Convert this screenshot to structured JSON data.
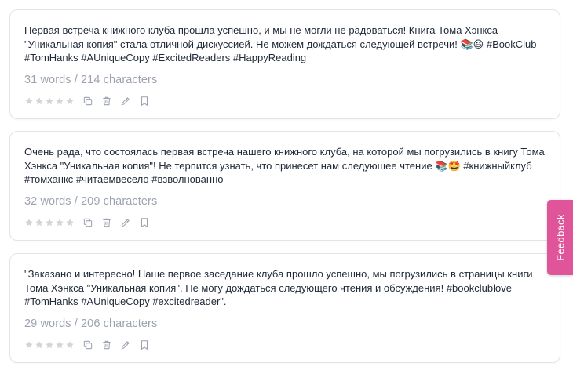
{
  "posts": [
    {
      "text": "Первая встреча книжного клуба прошла успешно, и мы не могли не радоваться! Книга Тома Хэнкса \"Уникальная копия\" стала отличной дискуссией. Не можем дождаться следующей встречи! 📚😃 #BookClub #TomHanks #AUniqueCopy #ExcitedReaders #HappyReading",
      "stats": "31 words / 214 characters",
      "rating": 0
    },
    {
      "text": "Очень рада, что состоялась первая встреча нашего книжного клуба, на которой мы погрузились в книгу Тома Хэнкса \"Уникальная копия\"! Не терпится узнать, что принесет нам следующее чтение 📚🤩 #книжныйклуб #томханкс #читаемвесело #взволнованно",
      "stats": "32 words / 209 characters",
      "rating": 0
    },
    {
      "text": "\"Заказано и интересно! Наше первое заседание клуба прошло успешно, мы погрузились в страницы книги Тома Хэнкса \"Уникальная копия\". Не могу дождаться следующего чтения и обсуждения! #bookclublove #TomHanks #AUniqueCopy #excitedreader\".",
      "stats": "29 words / 206 characters",
      "rating": 0
    }
  ],
  "icons": [
    "star-icon",
    "copy-icon",
    "trash-icon",
    "pencil-icon",
    "bookmark-icon"
  ],
  "colors": {
    "text": "#1f2937",
    "muted": "#9ca3af",
    "icon": "#9ca3af",
    "card_border": "#e4e4e7",
    "feedback_bg": "#e0559a"
  },
  "feedback": {
    "label": "Feedback"
  }
}
